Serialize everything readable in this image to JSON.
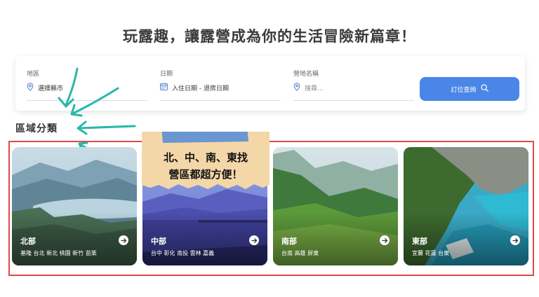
{
  "headline": "玩露趣，讓露營成為你的生活冒險新篇章！",
  "search": {
    "region_label": "地區",
    "region_value": "選擇縣市",
    "date_label": "日期",
    "date_value": "入住日期 - 退房日期",
    "site_label": "營地名稱",
    "site_placeholder": "搜尋...",
    "button_label": "訂位查詢"
  },
  "section_title": "區域分類",
  "overlay_note": {
    "line1": "北、中、南、東找",
    "line2": "營區都超方便！"
  },
  "regions": [
    {
      "name": "北部",
      "cities": "基隆 台北 新北 桃園 新竹 苗栗"
    },
    {
      "name": "中部",
      "cities": "台中 彰化 南投 雲林 嘉義"
    },
    {
      "name": "南部",
      "cities": "台南 高雄 屏東"
    },
    {
      "name": "東部",
      "cities": "宜蘭 花蓮 台東"
    }
  ],
  "colors": {
    "accent": "#4a86e8",
    "annotation_arrows": "#2ab7a9",
    "highlight_frame": "#e04848",
    "note_paper": "#f3d7a8",
    "note_tape": "#5b8fd6"
  }
}
